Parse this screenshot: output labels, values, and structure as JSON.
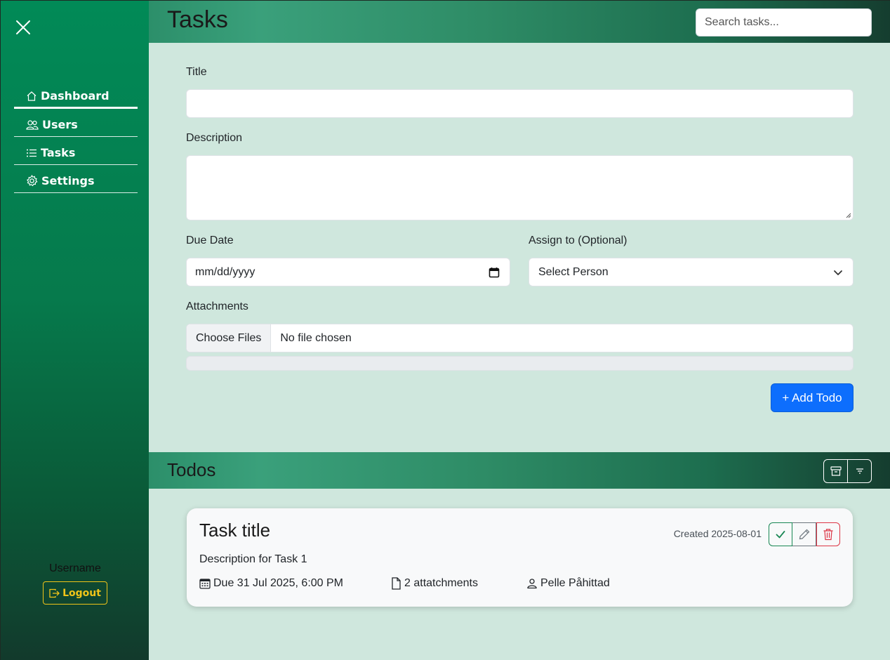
{
  "sidebar": {
    "items": [
      {
        "label": "Dashboard",
        "icon": "home-icon"
      },
      {
        "label": "Users",
        "icon": "users-icon"
      },
      {
        "label": "Tasks",
        "icon": "list-icon"
      },
      {
        "label": "Settings",
        "icon": "gear-icon"
      }
    ],
    "username": "Username",
    "logout_label": "Logout"
  },
  "header": {
    "title": "Tasks",
    "search_placeholder": "Search tasks..."
  },
  "form": {
    "title_label": "Title",
    "title_value": "",
    "description_label": "Description",
    "description_value": "",
    "due_date_label": "Due Date",
    "due_date_placeholder": "mm/dd/yyyy",
    "assign_label": "Assign to (Optional)",
    "assign_selected": "Select Person",
    "attachments_label": "Attachments",
    "choose_files_label": "Choose Files",
    "file_status": "No file chosen",
    "add_button_label": "+ Add Todo"
  },
  "todos": {
    "title": "Todos",
    "items": [
      {
        "title": "Task title",
        "created": "Created 2025-08-01",
        "description": "Description for Task 1",
        "due": "Due 31 Jul 2025, 6:00 PM",
        "attachments": "2 attatchments",
        "assignee": "Pelle Påhittad"
      }
    ]
  },
  "colors": {
    "primary": "#0d6efd",
    "success": "#198754",
    "danger": "#dc3545",
    "warning": "#f0c419",
    "sidebar_green": "#018a57",
    "background": "#cfe7dd"
  }
}
